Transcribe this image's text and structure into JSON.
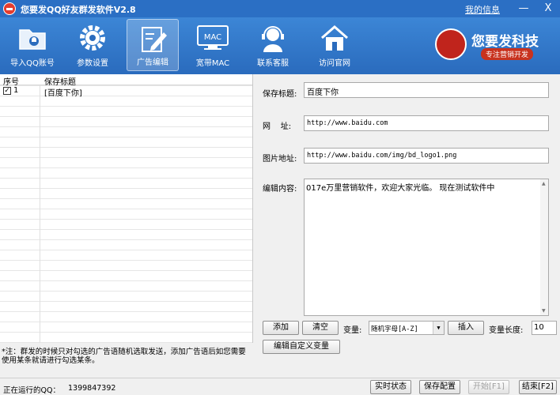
{
  "window": {
    "title": "您要发QQ好友群发软件V2.8",
    "my_info": "我的信息",
    "minimize": "—",
    "close": "X"
  },
  "toolbar": {
    "items": [
      {
        "label": "导入QQ账号",
        "icon": "folder-icon"
      },
      {
        "label": "参数设置",
        "icon": "gear-icon"
      },
      {
        "label": "广告编辑",
        "icon": "pencil-icon",
        "active": true
      },
      {
        "label": "宽带MAC",
        "icon": "mac-monitor-icon",
        "icon_text": "MAC"
      },
      {
        "label": "联系客服",
        "icon": "headset-icon"
      },
      {
        "label": "访问官网",
        "icon": "home-icon"
      }
    ],
    "brand": {
      "name": "您要发科技",
      "slogan": "专注营销开发"
    }
  },
  "list": {
    "columns": [
      "序号",
      "保存标题"
    ],
    "rows": [
      {
        "checked": true,
        "num": "1",
        "title": "[百度下你]"
      }
    ]
  },
  "note": "*注：群发的时候只对勾选的广告语随机选取发送，添加广告语后如您需要使用某条就请进行勾选某条。",
  "form": {
    "title_label": "保存标题:",
    "title_value": "百度下你",
    "url_label": "网    址:",
    "url_value": "http://www.baidu.com",
    "image_label": "图片地址:",
    "image_value": "http://www.baidu.com/img/bd_logo1.png",
    "content_label": "编辑内容:",
    "content_value": "017e万里营销软件，欢迎大家光临。 现在测试软件中"
  },
  "actions": {
    "add": "添加",
    "clear": "清空",
    "variable_label": "变量:",
    "variable_selected": "随机字母[A-Z]",
    "insert": "插入",
    "variable_length_label": "变量长度:",
    "variable_length_value": "10",
    "edit_custom_variable": "编辑自定义变量"
  },
  "status": {
    "running_label": "正在运行的QQ：",
    "running_qq": "1399847392",
    "realtime_status": "实时状态",
    "save_config": "保存配置",
    "start": "开始[F1]",
    "stop": "结束[F2]"
  }
}
